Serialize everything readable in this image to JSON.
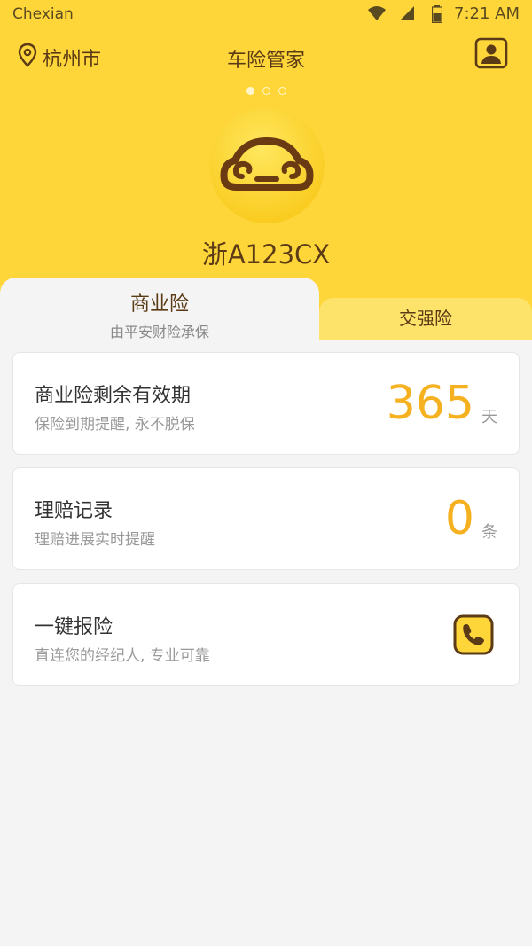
{
  "status_bar": {
    "carrier": "Chexian",
    "time": "7:21 AM"
  },
  "header": {
    "city": "杭州市",
    "title": "车险管家"
  },
  "carousel": {
    "pages": 3,
    "active": 0
  },
  "vehicle": {
    "plate": "浙A123CX"
  },
  "tabs": [
    {
      "label": "商业险",
      "subtitle": "由平安财险承保",
      "active": true
    },
    {
      "label": "交强险",
      "active": false
    }
  ],
  "cards": {
    "validity": {
      "title": "商业险剩余有效期",
      "subtitle": "保险到期提醒, 永不脱保",
      "value": "365",
      "unit": "天"
    },
    "claims": {
      "title": "理赔记录",
      "subtitle": "理赔进展实时提醒",
      "value": "0",
      "unit": "条"
    },
    "report": {
      "title": "一键报险",
      "subtitle": "直连您的经纪人, 专业可靠"
    }
  },
  "colors": {
    "brand_yellow": "#fed63a",
    "accent_orange": "#f5b120",
    "brown": "#5b3a16"
  }
}
